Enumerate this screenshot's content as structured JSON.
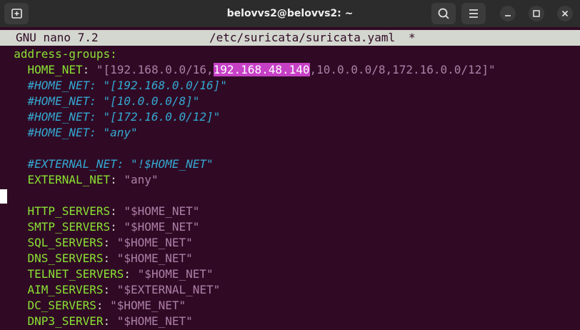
{
  "window": {
    "title": "belovvs2@belovvs2: ~"
  },
  "nano": {
    "app": "GNU nano 7.2",
    "file": "/etc/suricata/suricata.yaml",
    "modified": "*"
  },
  "lines": [
    {
      "key": "address-groups:"
    },
    {
      "key": "HOME_NET",
      "sep": ":",
      "vpre": "\"[192.168.0.0/16,",
      "vhl": "192.168.48.140",
      "vpost": ",10.0.0.0/8,172.16.0.0/12]\""
    },
    {
      "comment": "#HOME_NET: \"[192.168.0.0/16]\""
    },
    {
      "comment": "#HOME_NET: \"[10.0.0.0/8]\""
    },
    {
      "comment": "#HOME_NET: \"[172.16.0.0/12]\""
    },
    {
      "comment": "#HOME_NET: \"any\""
    },
    {
      "comment": "#EXTERNAL_NET: \"!$HOME_NET\""
    },
    {
      "key": "EXTERNAL_NET",
      "sep": ":",
      "value": "\"any\""
    },
    {
      "key": "HTTP_SERVERS",
      "sep": ":",
      "value": "\"$HOME_NET\""
    },
    {
      "key": "SMTP_SERVERS",
      "sep": ":",
      "value": "\"$HOME_NET\""
    },
    {
      "key": "SQL_SERVERS",
      "sep": ":",
      "value": "\"$HOME_NET\""
    },
    {
      "key": "DNS_SERVERS",
      "sep": ":",
      "value": "\"$HOME_NET\""
    },
    {
      "key": "TELNET_SERVERS",
      "sep": ":",
      "value": "\"$HOME_NET\""
    },
    {
      "key": "AIM_SERVERS",
      "sep": ":",
      "value": "\"$EXTERNAL_NET\""
    },
    {
      "key": "DC_SERVERS",
      "sep": ":",
      "value": "\"$HOME_NET\""
    },
    {
      "key": "DNP3_SERVER",
      "sep": ":",
      "value": "\"$HOME_NET\""
    }
  ],
  "icons": [
    "new-tab-icon",
    "search-icon",
    "hamburger-menu-icon",
    "minimize-icon",
    "maximize-icon",
    "close-icon"
  ],
  "colors": {
    "background": "#300a24",
    "key": "#8ae234",
    "string": "#ad7fa8",
    "comment": "#34a8d2",
    "highlight": "#c640c6",
    "titlebar": "#2c2c2c"
  }
}
